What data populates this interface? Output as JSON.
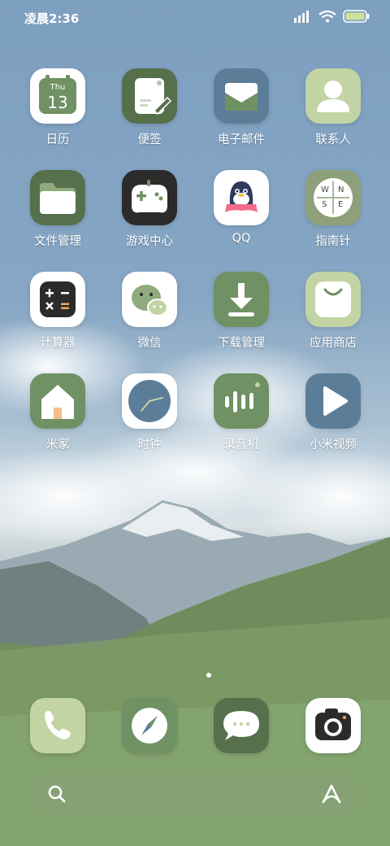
{
  "status_bar": {
    "time": "凌晨2:36"
  },
  "apps": [
    {
      "label": "日历",
      "icon": "calendar-icon",
      "calendar_day": "Thu",
      "calendar_date": "13"
    },
    {
      "label": "便签",
      "icon": "notes-icon"
    },
    {
      "label": "电子邮件",
      "icon": "mail-icon"
    },
    {
      "label": "联系人",
      "icon": "contacts-icon"
    },
    {
      "label": "文件管理",
      "icon": "folder-icon"
    },
    {
      "label": "游戏中心",
      "icon": "gamepad-icon"
    },
    {
      "label": "QQ",
      "icon": "qq-penguin-icon"
    },
    {
      "label": "指南针",
      "icon": "compass-icon",
      "compass_letters": [
        "W",
        "N",
        "S",
        "E"
      ]
    },
    {
      "label": "计算器",
      "icon": "calculator-icon"
    },
    {
      "label": "微信",
      "icon": "wechat-icon"
    },
    {
      "label": "下载管理",
      "icon": "download-icon"
    },
    {
      "label": "应用商店",
      "icon": "app-store-icon"
    },
    {
      "label": "米家",
      "icon": "home-icon"
    },
    {
      "label": "时钟",
      "icon": "clock-icon"
    },
    {
      "label": "录音机",
      "icon": "recorder-icon"
    },
    {
      "label": "小米视频",
      "icon": "video-play-icon"
    }
  ],
  "dock": [
    {
      "icon": "phone-icon"
    },
    {
      "icon": "browser-compass-icon"
    },
    {
      "icon": "messages-icon"
    },
    {
      "icon": "camera-icon"
    }
  ],
  "search_bar": {
    "left_icon": "search-icon",
    "right_icon": "assistant-icon"
  },
  "colors": {
    "icon_green": "#6f9163",
    "icon_dark_green": "#56704c",
    "icon_light_green": "#c3d4a4",
    "icon_blue": "#5c7d98",
    "icon_white": "#ffffff",
    "icon_black": "#2b2b2b"
  }
}
